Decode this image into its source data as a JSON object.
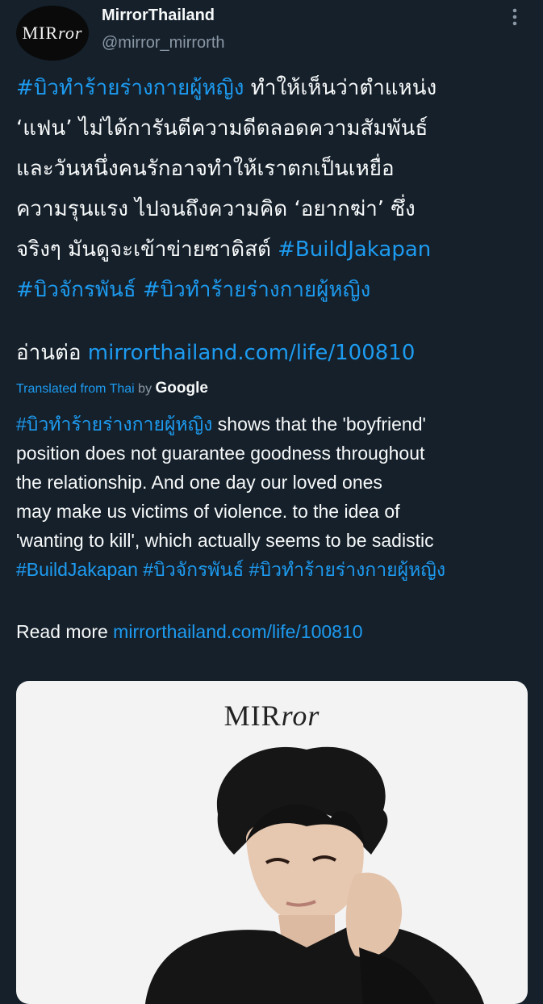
{
  "tweet": {
    "author": {
      "display_name": "MirrorThailand",
      "handle": "@mirror_mirrorth",
      "avatar_logo_main": "MIR",
      "avatar_logo_italic": "ror"
    },
    "more_icon": "more-vertical-icon",
    "thai_lines": [
      [
        {
          "t": "#บิวทำร้ายร่างกายผู้หญิง",
          "link": true
        },
        {
          "t": " ทำให้เห็นว่าตำแหน่ง",
          "link": false
        }
      ],
      [
        {
          "t": "‘แฟน’ ไม่ได้การันตีความดีตลอดความสัมพันธ์",
          "link": false
        }
      ],
      [
        {
          "t": "และวันหนึ่งคนรักอาจทำให้เราตกเป็นเหยื่อ",
          "link": false
        }
      ],
      [
        {
          "t": "ความรุนแรง ไปจนถึงความคิด ‘อยากฆ่า’ ซึ่ง",
          "link": false
        }
      ],
      [
        {
          "t": "จริงๆ มันดูจะเข้าข่ายซาดิสต์ ",
          "link": false
        },
        {
          "t": "#BuildJakapan",
          "link": true
        }
      ],
      [
        {
          "t": "#บิวจักรพันธ์",
          "link": true
        },
        {
          "t": " ",
          "link": false
        },
        {
          "t": "#บิวทำร้ายร่างกายผู้หญิง",
          "link": true
        }
      ]
    ],
    "read_more_th": {
      "label": "อ่านต่อ ",
      "url": "mirrorthailand.com/life/100810"
    },
    "translation": {
      "prefix": "Translated from Thai ",
      "by": "by ",
      "provider": "Google"
    },
    "english_lines": [
      [
        {
          "t": "#บิวทำร้ายร่างกายผู้หญิง",
          "link": true
        },
        {
          "t": " shows that the 'boyfriend'",
          "link": false
        }
      ],
      [
        {
          "t": "position does not guarantee goodness throughout",
          "link": false
        }
      ],
      [
        {
          "t": "the relationship. And one day our loved ones",
          "link": false
        }
      ],
      [
        {
          "t": "may make us victims of violence. to the idea of",
          "link": false
        }
      ],
      [
        {
          "t": "'wanting to kill', which actually seems to be sadistic",
          "link": false
        }
      ],
      [
        {
          "t": "#BuildJakapan",
          "link": true
        },
        {
          "t": " ",
          "link": false
        },
        {
          "t": "#บิวจักรพันธ์",
          "link": true
        },
        {
          "t": " ",
          "link": false
        },
        {
          "t": "#บิวทำร้ายร่างกายผู้หญิง",
          "link": true
        }
      ]
    ],
    "read_more_en": {
      "label": "Read more ",
      "url": "mirrorthailand.com/life/100810"
    },
    "media": {
      "logo_main": "MIR",
      "logo_italic": "ror"
    }
  },
  "colors": {
    "background": "#15202b",
    "link": "#1d9bf0",
    "text_primary": "#f7f9f9",
    "text_secondary": "#8b98a5"
  }
}
